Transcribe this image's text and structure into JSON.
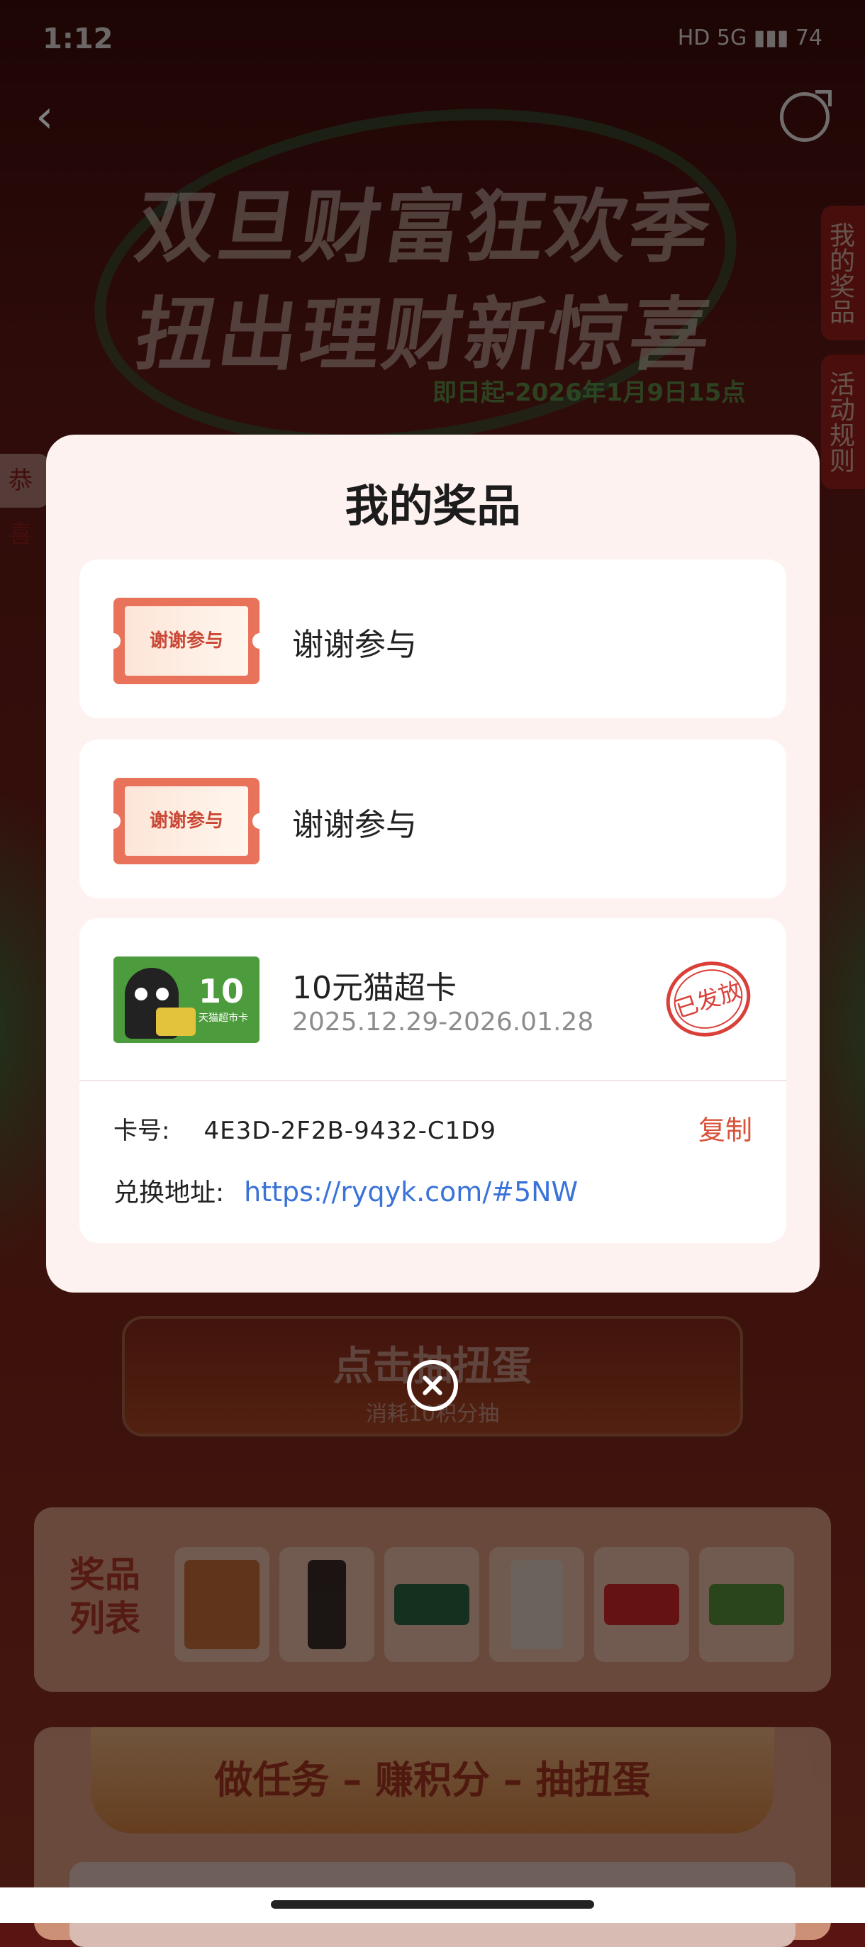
{
  "status": {
    "time": "1:12",
    "icons": "HD 5G ▮▮▮ 74",
    "battery": "74"
  },
  "banner": {
    "line1": "双旦财富狂欢季",
    "line2": "扭出理财新惊喜",
    "date": "即日起-2026年1月9日15点"
  },
  "side_tabs": {
    "my_prizes": "我的奖品",
    "rules": "活动规则"
  },
  "left_peek": "恭喜",
  "draw_button": {
    "label": "点击抽扭蛋",
    "sub": "消耗10积分抽"
  },
  "prize_list": {
    "title": "奖品列表",
    "items": [
      "phone",
      "camera",
      "starbucks-card",
      "thermos",
      "jd-card",
      "tmall-card"
    ]
  },
  "task_panel": {
    "header": "做任务 – 赚积分 – 抽扭蛋"
  },
  "modal": {
    "title": "我的奖品",
    "cards": [
      {
        "ticket_text": "谢谢参与",
        "name": "谢谢参与"
      },
      {
        "ticket_text": "谢谢参与",
        "name": "谢谢参与"
      },
      {
        "name": "10元猫超卡",
        "validity": "2025.12.29-2026.01.28",
        "thumb_value": "10",
        "thumb_sub": "天猫超市卡",
        "stamp": "已发放",
        "card_no_label": "卡号:",
        "card_no": "4E3D-2F2B-9432-C1D9",
        "copy_label": "复制",
        "redeem_label": "兑换地址:",
        "redeem_url": "https://ryqyk.com/#5NW"
      }
    ]
  },
  "colors": {
    "accent": "#d9523a",
    "link": "#3a73d8",
    "stamp": "#d9403a"
  }
}
